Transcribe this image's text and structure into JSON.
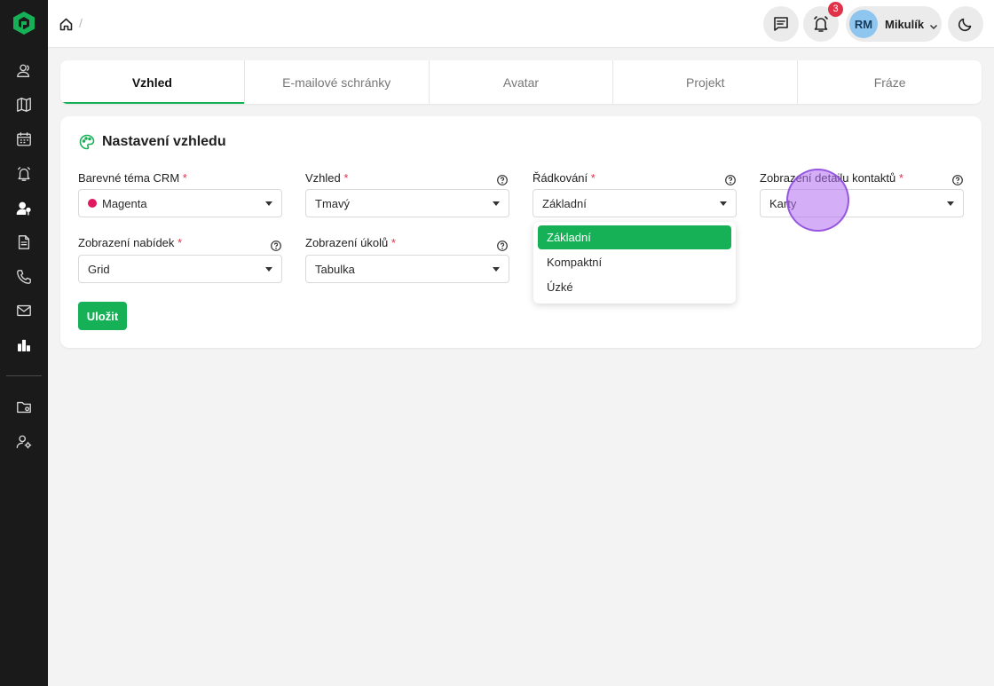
{
  "topbar": {
    "breadcrumb_sep": "/",
    "notifications_count": "3",
    "user": {
      "initials": "RM",
      "name": "Mikulík"
    }
  },
  "sidebar": {
    "items": [
      "contacts-icon",
      "map-icon",
      "calendar-icon",
      "alarm-icon",
      "user-pin-icon",
      "document-icon",
      "phone-icon",
      "mail-icon",
      "chart-icon",
      "folder-settings-icon",
      "user-settings-icon"
    ]
  },
  "tabs": [
    {
      "label": "Vzhled",
      "active": true
    },
    {
      "label": "E-mailové schránky",
      "active": false
    },
    {
      "label": "Avatar",
      "active": false
    },
    {
      "label": "Projekt",
      "active": false
    },
    {
      "label": "Fráze",
      "active": false
    }
  ],
  "card": {
    "title": "Nastavení vzhledu",
    "fields": {
      "theme": {
        "label": "Barevné téma CRM",
        "required": "*",
        "value": "Magenta",
        "dot_color": "#e0185f"
      },
      "appearance": {
        "label": "Vzhled",
        "required": "*",
        "value": "Tmavý"
      },
      "row_spacing": {
        "label": "Řádkování",
        "required": "*",
        "value": "Základní"
      },
      "contact_detail": {
        "label": "Zobrazení detailu kontaktů",
        "required": "*",
        "value": "Karty"
      },
      "offers_view": {
        "label": "Zobrazení nabídek",
        "required": "*",
        "value": "Grid"
      },
      "tasks_view": {
        "label": "Zobrazení úkolů",
        "required": "*",
        "value": "Tabulka"
      }
    },
    "save_label": "Uložit"
  },
  "dropdown": {
    "options": [
      {
        "label": "Základní",
        "selected": true
      },
      {
        "label": "Kompaktní",
        "selected": false
      },
      {
        "label": "Úzké",
        "selected": false
      }
    ]
  },
  "colors": {
    "accent": "#16b157",
    "required": "#e0334a",
    "sidebar": "#1a1a1a"
  }
}
